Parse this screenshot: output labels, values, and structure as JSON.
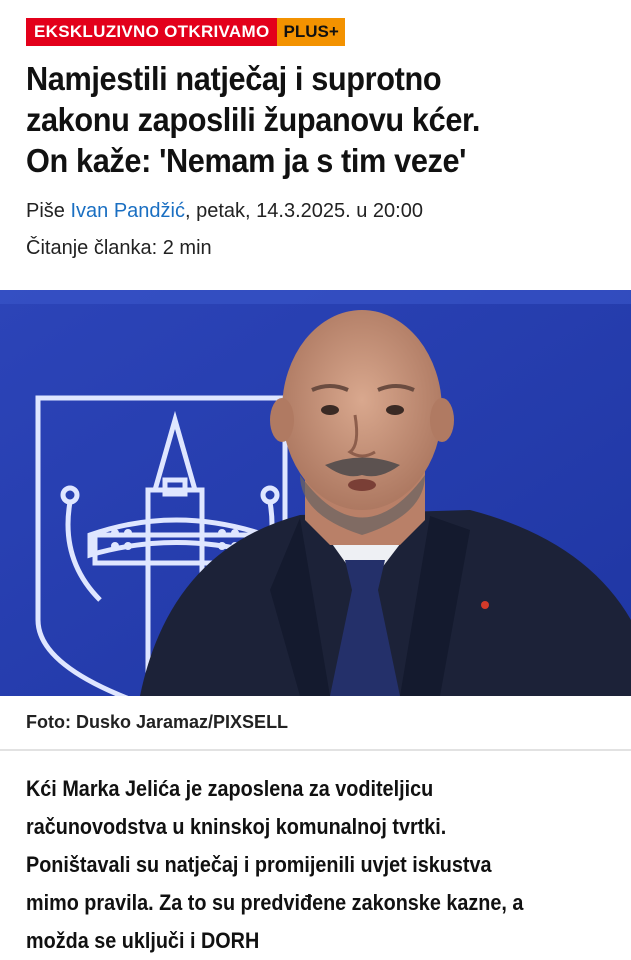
{
  "badges": {
    "exclusive": "EKSKLUZIVNO OTKRIVAMO",
    "plus": "PLUS+"
  },
  "headline_lines": [
    "Namjestili natječaj i suprotno",
    "zakonu zaposlili županovu kćer.",
    "On kaže: 'Nemam ja s tim veze'"
  ],
  "byline": {
    "prefix": "Piše ",
    "author": "Ivan Pandžić",
    "date": ", petak, 14.3.2025. u 20:00"
  },
  "reading_time": "Čitanje članka: 2 min",
  "photo_caption": "Foto: Dusko Jaramaz/PIXSELL",
  "lead_lines": [
    "Kći Marka Jelića je zaposlena za voditeljicu",
    "računovodstva u kninskoj komunalnoj tvrtki.",
    "Poništavali su natječaj i promijenili uvjet iskustva",
    "mimo pravila. Za to su predviđene zakonske kazne, a",
    "možda se uključi i DORH"
  ],
  "colors": {
    "exclusive_badge": "#e3001b",
    "plus_badge": "#f39200",
    "author_link": "#1a6fc2",
    "photo_background": "#2a3fb0"
  }
}
